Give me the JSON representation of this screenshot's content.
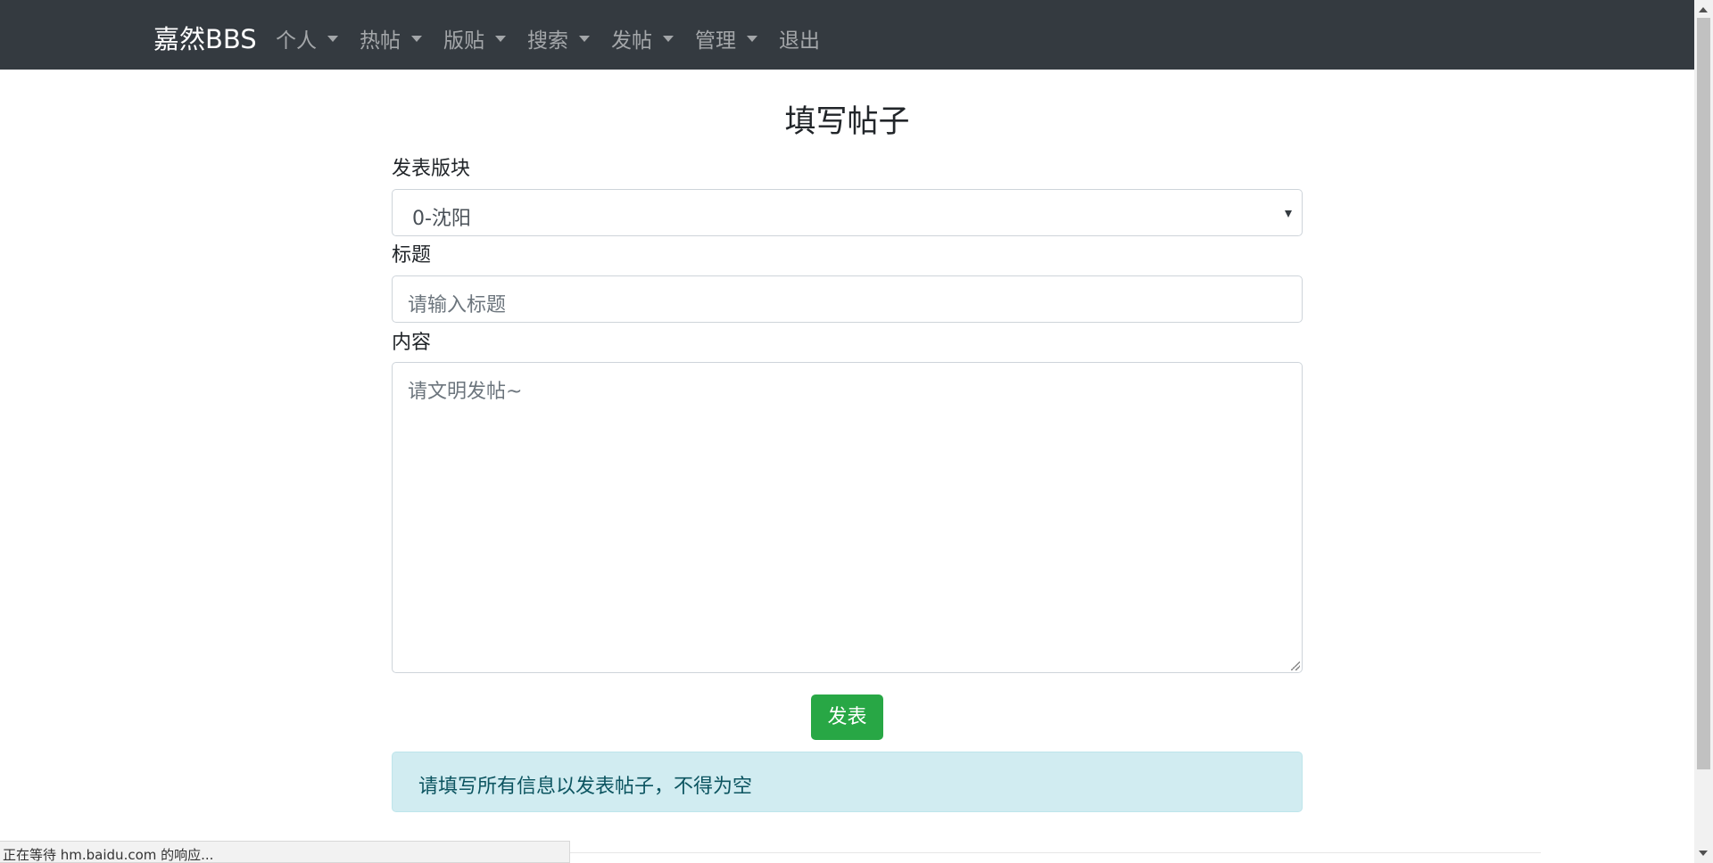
{
  "navbar": {
    "brand": "嘉然BBS",
    "items": [
      {
        "label": "个人",
        "dropdown": true
      },
      {
        "label": "热帖",
        "dropdown": true
      },
      {
        "label": "版贴",
        "dropdown": true
      },
      {
        "label": "搜索",
        "dropdown": true
      },
      {
        "label": "发帖",
        "dropdown": true
      },
      {
        "label": "管理",
        "dropdown": true
      },
      {
        "label": "退出",
        "dropdown": false
      }
    ]
  },
  "form": {
    "title": "填写帖子",
    "board_label": "发表版块",
    "board_selected": "0-沈阳",
    "title_label": "标题",
    "title_placeholder": "请输入标题",
    "content_label": "内容",
    "content_placeholder": "请文明发帖~",
    "submit_label": "发表"
  },
  "alert": {
    "message": "请填写所有信息以发表帖子，不得为空"
  },
  "status_bar": {
    "text": "正在等待 hm.baidu.com 的响应..."
  },
  "colors": {
    "navbar_bg": "#343a40",
    "submit_bg": "#28a745",
    "alert_bg": "#d1ecf1",
    "alert_text": "#0c5460"
  }
}
